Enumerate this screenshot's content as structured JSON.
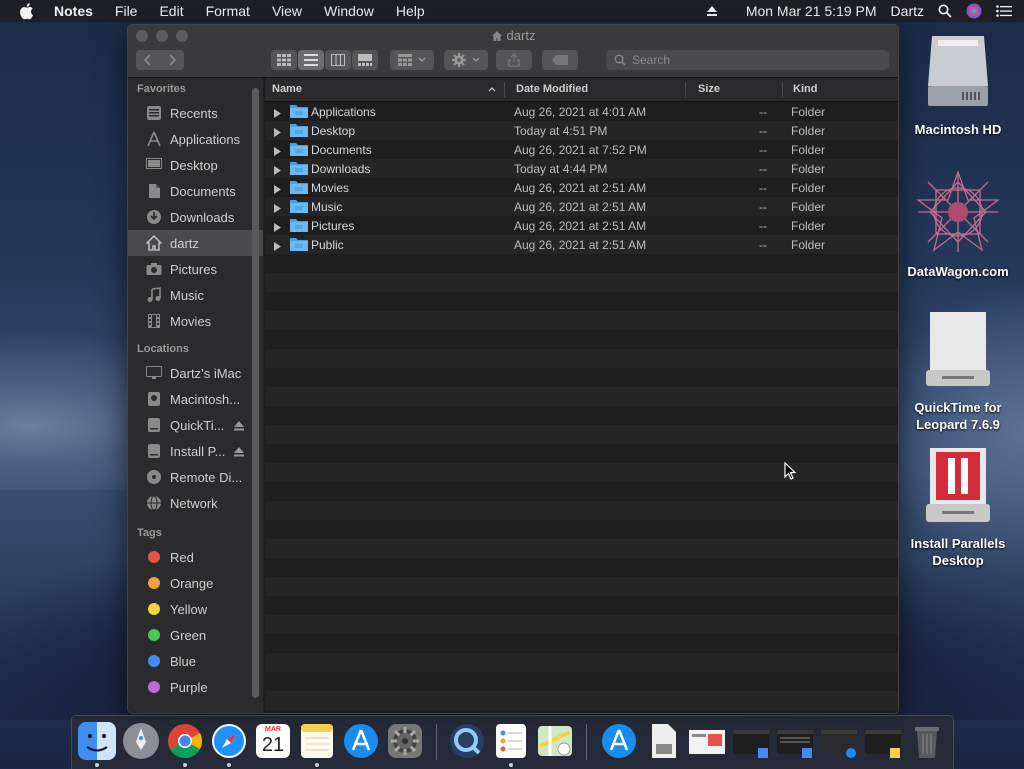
{
  "menubar": {
    "app": "Notes",
    "items": [
      "File",
      "Edit",
      "Format",
      "View",
      "Window",
      "Help"
    ],
    "datetime": "Mon Mar 21  5:19 PM",
    "user": "Dartz"
  },
  "window": {
    "title": "dartz",
    "search_placeholder": "Search"
  },
  "sidebar": {
    "favorites_label": "Favorites",
    "favorites": [
      {
        "label": "Recents",
        "icon": "clock-icon"
      },
      {
        "label": "Applications",
        "icon": "applications-icon"
      },
      {
        "label": "Desktop",
        "icon": "desktop-icon"
      },
      {
        "label": "Documents",
        "icon": "document-icon"
      },
      {
        "label": "Downloads",
        "icon": "download-icon"
      },
      {
        "label": "dartz",
        "icon": "home-icon",
        "selected": true
      },
      {
        "label": "Pictures",
        "icon": "camera-icon"
      },
      {
        "label": "Music",
        "icon": "music-icon"
      },
      {
        "label": "Movies",
        "icon": "film-icon"
      }
    ],
    "locations_label": "Locations",
    "locations": [
      {
        "label": "Dartz’s iMac",
        "icon": "imac-icon"
      },
      {
        "label": "Macintosh...",
        "icon": "disk-icon"
      },
      {
        "label": "QuickTi...",
        "icon": "drive-icon",
        "eject": true
      },
      {
        "label": "Install P...",
        "icon": "drive-icon",
        "eject": true
      },
      {
        "label": "Remote Di...",
        "icon": "disc-icon"
      },
      {
        "label": "Network",
        "icon": "globe-icon"
      }
    ],
    "tags_label": "Tags",
    "tags": [
      {
        "label": "Red",
        "color": "#e5534b"
      },
      {
        "label": "Orange",
        "color": "#f0a040"
      },
      {
        "label": "Yellow",
        "color": "#f2d53c"
      },
      {
        "label": "Green",
        "color": "#4cc552"
      },
      {
        "label": "Blue",
        "color": "#3d8ef0"
      },
      {
        "label": "Purple",
        "color": "#c068d8"
      }
    ]
  },
  "columns": {
    "name": "Name",
    "date": "Date Modified",
    "size": "Size",
    "kind": "Kind"
  },
  "files": [
    {
      "name": "Applications",
      "date": "Aug 26, 2021 at 4:01 AM",
      "size": "--",
      "kind": "Folder"
    },
    {
      "name": "Desktop",
      "date": "Today at 4:51 PM",
      "size": "--",
      "kind": "Folder"
    },
    {
      "name": "Documents",
      "date": "Aug 26, 2021 at 7:52 PM",
      "size": "--",
      "kind": "Folder"
    },
    {
      "name": "Downloads",
      "date": "Today at 4:44 PM",
      "size": "--",
      "kind": "Folder"
    },
    {
      "name": "Movies",
      "date": "Aug 26, 2021 at 2:51 AM",
      "size": "--",
      "kind": "Folder"
    },
    {
      "name": "Music",
      "date": "Aug 26, 2021 at 2:51 AM",
      "size": "--",
      "kind": "Folder"
    },
    {
      "name": "Pictures",
      "date": "Aug 26, 2021 at 2:51 AM",
      "size": "--",
      "kind": "Folder"
    },
    {
      "name": "Public",
      "date": "Aug 26, 2021 at 2:51 AM",
      "size": "--",
      "kind": "Folder"
    }
  ],
  "desktop_icons": [
    {
      "label": "Macintosh HD",
      "icon": "hard-drive-icon"
    },
    {
      "label": "DataWagon.com",
      "icon": "star-pattern-icon"
    },
    {
      "label": "QuickTime for Leopard 7.6.9",
      "icon": "disk-image-icon"
    },
    {
      "label": "Install Parallels Desktop",
      "icon": "parallels-icon"
    }
  ],
  "dock": {
    "calendar_month": "MAR",
    "calendar_day": "21"
  }
}
